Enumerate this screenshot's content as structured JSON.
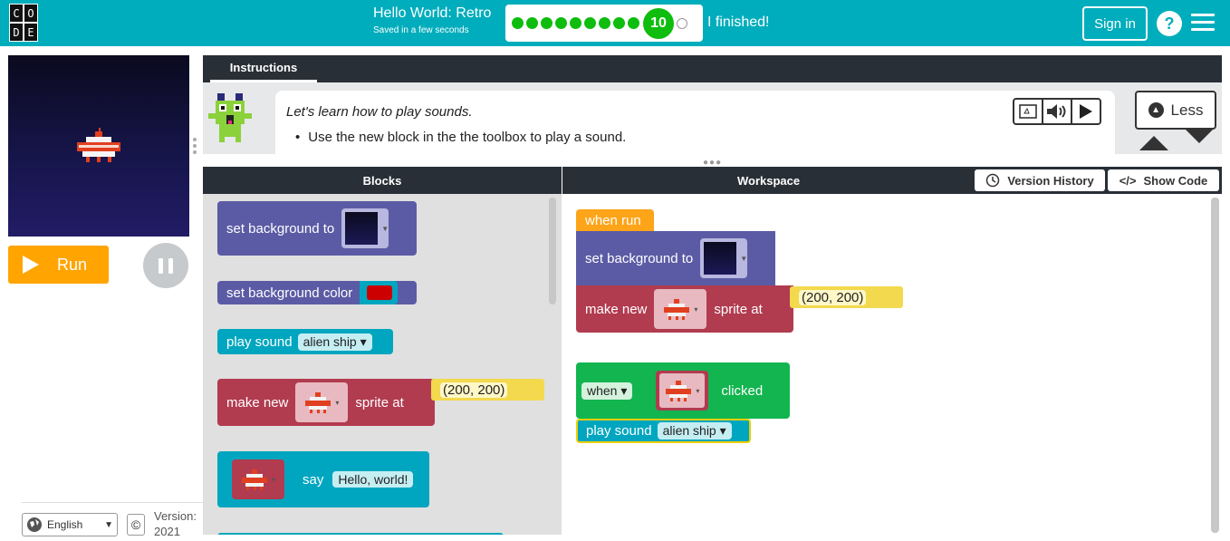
{
  "header": {
    "logo_letters": [
      "C",
      "O",
      "",
      "D",
      "E",
      ""
    ],
    "title": "Hello World: Retro",
    "saved_status": "Saved in a few seconds",
    "progress_completed_dots": 9,
    "current_level": "10",
    "finished_label": "I finished!",
    "sign_in_label": "Sign in",
    "help_label": "?"
  },
  "left": {
    "run_label": "Run",
    "language": "English",
    "copyright_symbol": "©",
    "version_label": "Version:",
    "version_year": "2021"
  },
  "instructions": {
    "tab_label": "Instructions",
    "line1": "Let's learn how to play sounds.",
    "line2": "Use the new block in the the toolbox to play a sound.",
    "less_label": "Less"
  },
  "panels": {
    "blocks_header": "Blocks",
    "workspace_header": "Workspace",
    "version_history_label": "Version History",
    "show_code_label": "Show Code"
  },
  "toolbox": {
    "set_background": "set background to",
    "set_background_color": "set background color",
    "play_sound": "play sound",
    "sound_name": "alien ship",
    "make_new": "make new",
    "sprite_at": "sprite at",
    "coords": "(200, 200)",
    "say": "say",
    "say_text": "Hello, world!"
  },
  "workspace": {
    "when_run": "when run",
    "set_background": "set background to",
    "make_new": "make new",
    "sprite_at": "sprite at",
    "coords": "(200, 200)",
    "when": "when",
    "clicked": "clicked",
    "play_sound": "play sound",
    "sound_name": "alien ship"
  },
  "colors": {
    "topbar": "#00adbc",
    "run_button": "#ffa400",
    "progress_green": "#0ebd0e",
    "block_purple": "#5b5ba5",
    "block_red": "#b13b4f",
    "block_teal": "#00a6bf",
    "block_green": "#12b54f",
    "block_orange": "#fda419"
  }
}
